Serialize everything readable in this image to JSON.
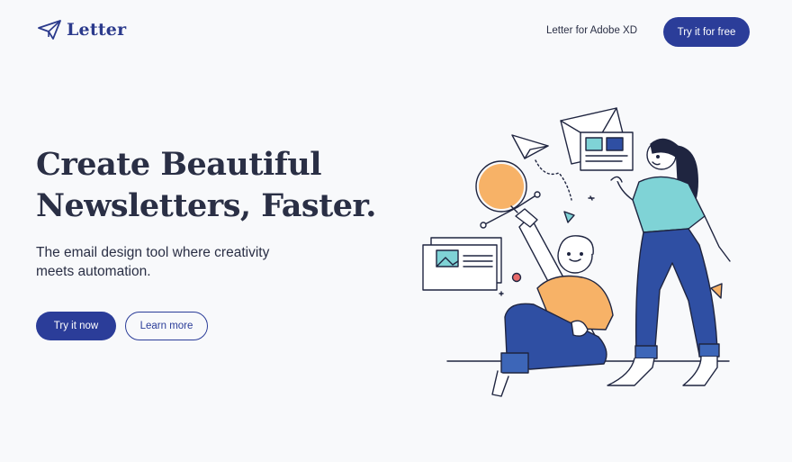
{
  "brand": {
    "name": "Letter",
    "logo_icon": "paper-plane-icon"
  },
  "nav": {
    "link_label": "Letter for Adobe XD",
    "cta_label": "Try it for free"
  },
  "hero": {
    "title_line1": "Create Beautiful",
    "title_line2": "Newsletters, Faster.",
    "subtitle": "The email design tool where creativity meets automation.",
    "primary_button": "Try it now",
    "secondary_button": "Learn more"
  },
  "colors": {
    "brand_blue": "#2b3d99",
    "text_dark": "#2a2f45",
    "accent_orange": "#f7b267",
    "accent_teal": "#7fd3d6",
    "denim": "#2f4fa3",
    "background": "#f8f9fb"
  }
}
